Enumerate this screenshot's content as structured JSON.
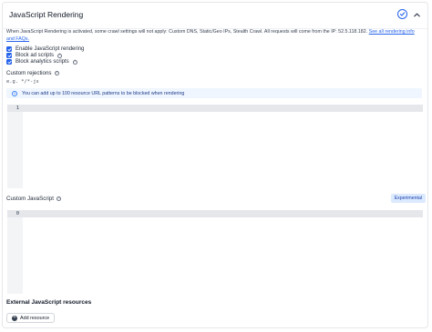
{
  "header": {
    "title": "JavaScript Rendering"
  },
  "info": {
    "text": "When JavaScript Rendering is activated, some crawl settings will not apply: Custom DNS, Static/Geo IPs, Stealth Crawl. All requests will come from the IP: 52.5.118.182.",
    "link": "See all rendering info and FAQs."
  },
  "checkboxes": [
    {
      "label": "Enable JavaScript rendering",
      "checked": true
    },
    {
      "label": "Block ad scripts",
      "checked": true
    },
    {
      "label": "Block analytics scripts",
      "checked": true
    }
  ],
  "custom_rejections": {
    "label": "Custom rejections",
    "hint": "e.g. */*-js",
    "alert": "You can add up to 100 resource URL patterns to be blocked when rendering",
    "line_number": "1"
  },
  "custom_js": {
    "label": "Custom JavaScript",
    "badge": "Experimental",
    "line_number": "0"
  },
  "external": {
    "title": "External JavaScript resources",
    "add_button": "Add resource"
  },
  "colors": {
    "accent": "#2563eb",
    "alert_bg": "#eff6ff",
    "badge_bg": "#dbeafe"
  }
}
